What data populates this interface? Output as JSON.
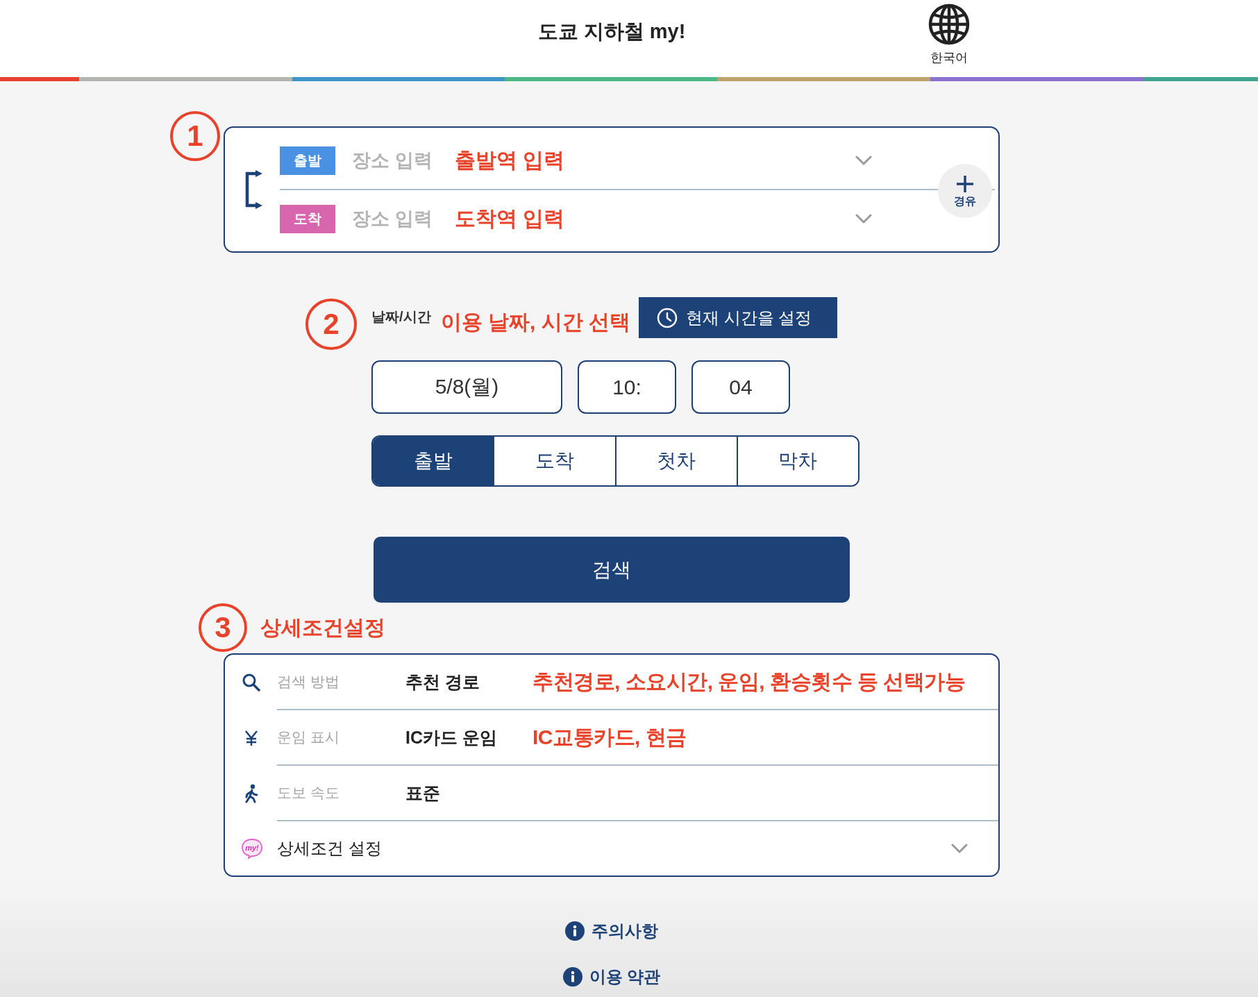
{
  "header": {
    "title": "도쿄 지하철 my!",
    "language": "한국어"
  },
  "route": {
    "marker": "1",
    "fields": [
      {
        "badge": "출발",
        "color": "#4b91e3",
        "placeholder": "장소 입력",
        "note": "출발역 입력"
      },
      {
        "badge": "도착",
        "color": "#d766ae",
        "placeholder": "장소 입력",
        "note": "도착역 입력"
      }
    ],
    "via_button": "경유"
  },
  "datetime": {
    "marker": "2",
    "label": "날짜/시간",
    "note": "이용 날짜, 시간 선택",
    "now_button": "현재 시간을 설정",
    "date": "5/8(월)",
    "hour": "10:",
    "minute": "04",
    "modes": [
      {
        "label": "출발",
        "selected": true
      },
      {
        "label": "도착",
        "selected": false
      },
      {
        "label": "첫차",
        "selected": false
      },
      {
        "label": "막차",
        "selected": false
      }
    ]
  },
  "search_button": "검색",
  "conditions": {
    "marker": "3",
    "title": "상세조건설정",
    "rows": [
      {
        "kind": "search",
        "label": "검색 방법",
        "value": "추천 경로",
        "note": "추천경로, 소요시간, 운임, 환승횟수 등 선택가능"
      },
      {
        "kind": "fare",
        "label": "운임 표시",
        "value": "IC카드 운임",
        "note": "IC교통카드, 현금"
      },
      {
        "kind": "walk",
        "label": "도보 속도",
        "value": "표준"
      }
    ],
    "more": {
      "label": "상세조건 설정",
      "logo_text": "my!",
      "expanded": false
    }
  },
  "links": [
    "주의사항",
    "이용 약관"
  ]
}
